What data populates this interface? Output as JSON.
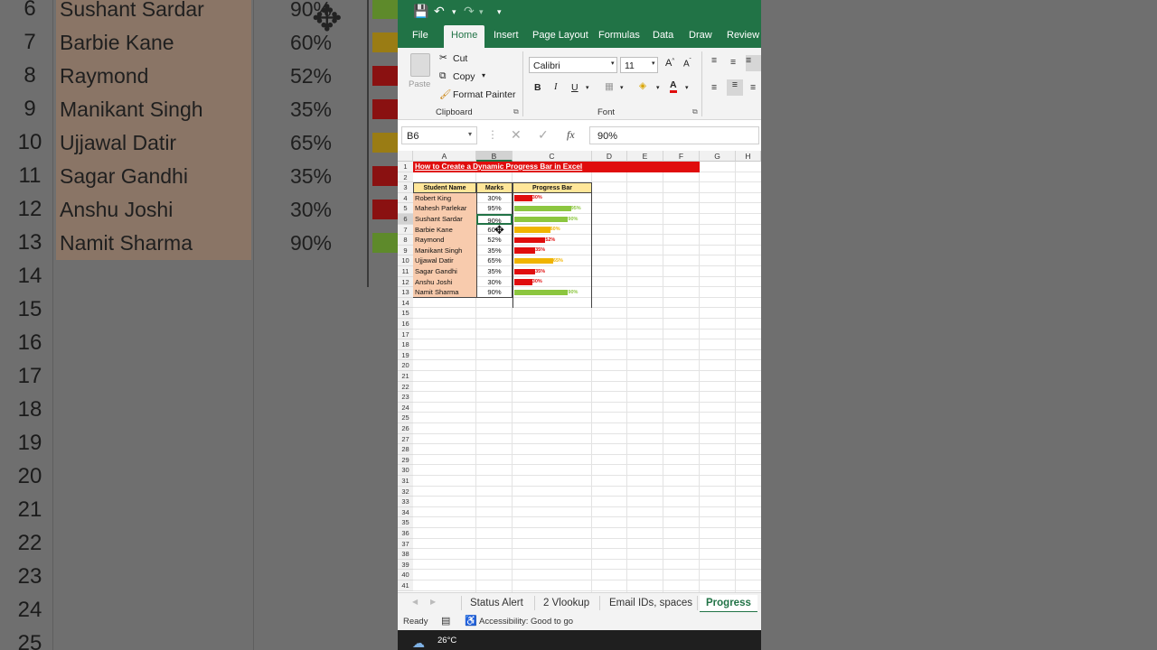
{
  "app": {
    "ribbon_tabs": [
      "File",
      "Home",
      "Insert",
      "Page Layout",
      "Formulas",
      "Data",
      "Draw",
      "Review"
    ],
    "active_tab": "Home"
  },
  "clipboard": {
    "paste": "Paste",
    "cut": "Cut",
    "copy": "Copy",
    "format_painter": "Format Painter",
    "label": "Clipboard"
  },
  "font": {
    "family": "Calibri",
    "size": "11",
    "bold": "B",
    "italic": "I",
    "underline": "U",
    "label": "Font"
  },
  "formula_bar": {
    "name_box": "B6",
    "fx": "fx",
    "value": "90%"
  },
  "sheet": {
    "columns": [
      "A",
      "B",
      "C",
      "D",
      "E",
      "F",
      "G",
      "H"
    ],
    "title": "How to Create a Dynamic Progress Bar in Excel",
    "headers": [
      "Student Name",
      "Marks",
      "Progress Bar"
    ],
    "rows": [
      {
        "name": "Robert King",
        "marks": "30%",
        "value": 0.3,
        "color": "#e00d0d"
      },
      {
        "name": "Mahesh Parlekar",
        "marks": "95%",
        "value": 0.95,
        "color": "#8cc63f"
      },
      {
        "name": "Sushant Sardar",
        "marks": "90%",
        "value": 0.9,
        "color": "#8cc63f"
      },
      {
        "name": "Barbie Kane",
        "marks": "60%",
        "value": 0.6,
        "color": "#f0b400"
      },
      {
        "name": "Raymond",
        "marks": "52%",
        "value": 0.52,
        "color": "#e00d0d"
      },
      {
        "name": "Manikant Singh",
        "marks": "35%",
        "value": 0.35,
        "color": "#e00d0d"
      },
      {
        "name": "Ujjawal Datir",
        "marks": "65%",
        "value": 0.65,
        "color": "#f0b400"
      },
      {
        "name": "Sagar Gandhi",
        "marks": "35%",
        "value": 0.35,
        "color": "#e00d0d"
      },
      {
        "name": "Anshu Joshi",
        "marks": "30%",
        "value": 0.3,
        "color": "#e00d0d"
      },
      {
        "name": "Namit Sharma",
        "marks": "90%",
        "value": 0.9,
        "color": "#8cc63f"
      }
    ],
    "row_numbers": [
      "1",
      "2",
      "3",
      "4",
      "5",
      "6",
      "7",
      "8",
      "9",
      "10",
      "11",
      "12",
      "13",
      "14",
      "15",
      "16",
      "17",
      "18",
      "19",
      "20",
      "21",
      "22",
      "23",
      "24",
      "25",
      "26",
      "27",
      "28",
      "29",
      "30",
      "31",
      "32",
      "33",
      "34",
      "35",
      "36",
      "37",
      "38",
      "39",
      "40",
      "41"
    ]
  },
  "sheet_tabs": [
    "Status Alert",
    "2 Vlookup",
    "Email IDs, spaces",
    "Progress"
  ],
  "active_sheet": "Progress",
  "status": {
    "ready": "Ready",
    "accessibility": "Accessibility: Good to go"
  },
  "taskbar": {
    "temperature": "26°C"
  },
  "background": {
    "rows": [
      {
        "num": "6",
        "name": "Sushant Sardar",
        "mark": "90%",
        "color": "#5e8a2b"
      },
      {
        "num": "7",
        "name": "Barbie Kane",
        "mark": "60%",
        "color": "#9a7c14"
      },
      {
        "num": "8",
        "name": "Raymond",
        "mark": "52%",
        "color": "#8a1111"
      },
      {
        "num": "9",
        "name": "Manikant Singh",
        "mark": "35%",
        "color": "#8a1111"
      },
      {
        "num": "10",
        "name": "Ujjawal Datir",
        "mark": "65%",
        "color": "#9a7c14"
      },
      {
        "num": "11",
        "name": "Sagar Gandhi",
        "mark": "35%",
        "color": "#8a1111"
      },
      {
        "num": "12",
        "name": "Anshu Joshi",
        "mark": "30%",
        "color": "#8a1111"
      },
      {
        "num": "13",
        "name": "Namit Sharma",
        "mark": "90%",
        "color": "#5e8a2b"
      }
    ],
    "extra_nums": [
      "14",
      "15",
      "16",
      "17",
      "18",
      "19",
      "20",
      "21",
      "22",
      "23",
      "24",
      "25"
    ]
  },
  "colors": {
    "excel_green": "#217346",
    "header_fill": "#ffe699",
    "name_fill": "#f8cbad",
    "title_fill": "#e00d0d"
  }
}
